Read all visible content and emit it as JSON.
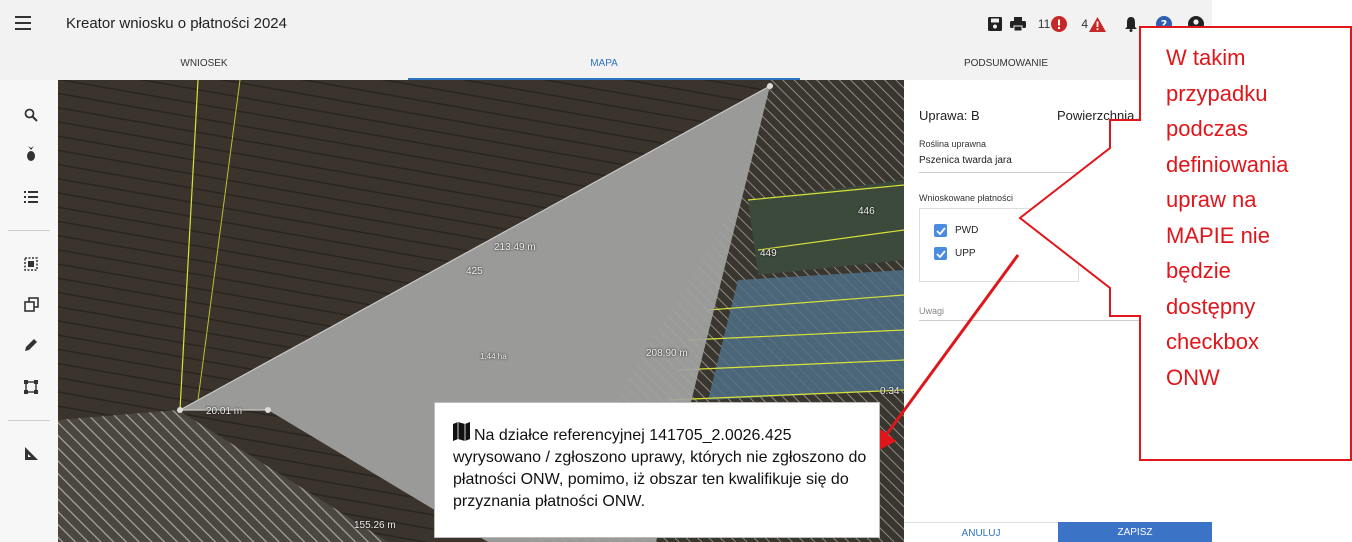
{
  "app": {
    "title": "Kreator wniosku o płatności 2024",
    "error_count": "11",
    "warning_count": "4"
  },
  "tabs": [
    {
      "label": "WNIOSEK",
      "active": false
    },
    {
      "label": "MAPA",
      "active": true
    },
    {
      "label": "PODSUMOWANIE",
      "active": false
    }
  ],
  "map": {
    "labels": [
      "213.49 m",
      "425",
      "446",
      "449",
      "1.44 ha",
      "208.90 m",
      "20.01 m",
      "155.26 m",
      "0.34"
    ]
  },
  "panel": {
    "title": "Uprawa: B",
    "area_label": "Powierzchnia",
    "crop_label": "Roślina uprawna",
    "crop_value": "Pszenica twarda jara",
    "payments_label": "Wnioskowane płatności",
    "payments": [
      {
        "label": "PWD",
        "checked": true
      },
      {
        "label": "UPP",
        "checked": true
      }
    ],
    "notes_label": "Uwagi",
    "cancel_label": "ANULUJ",
    "save_label": "ZAPISZ"
  },
  "callout": {
    "lines": [
      "W takim",
      "przypadku",
      "podczas",
      "definiowania",
      "upraw na",
      "MAPIE nie",
      "będzie",
      "dostępny",
      "checkbox",
      "ONW"
    ],
    "color": "#e0161b"
  },
  "info": {
    "icon": "map-icon",
    "text": "Na działce referencyjnej 141705_2.0026.425 wyrysowano / zgłoszono uprawy, których nie zgłoszono do płatności ONW, pomimo, iż obszar ten kwalifikuje się do przyznania płatności ONW."
  },
  "colors": {
    "accent": "#2f74c0",
    "save_button": "#3b73c6",
    "error": "#c62828",
    "checkbox": "#4a8de0"
  }
}
